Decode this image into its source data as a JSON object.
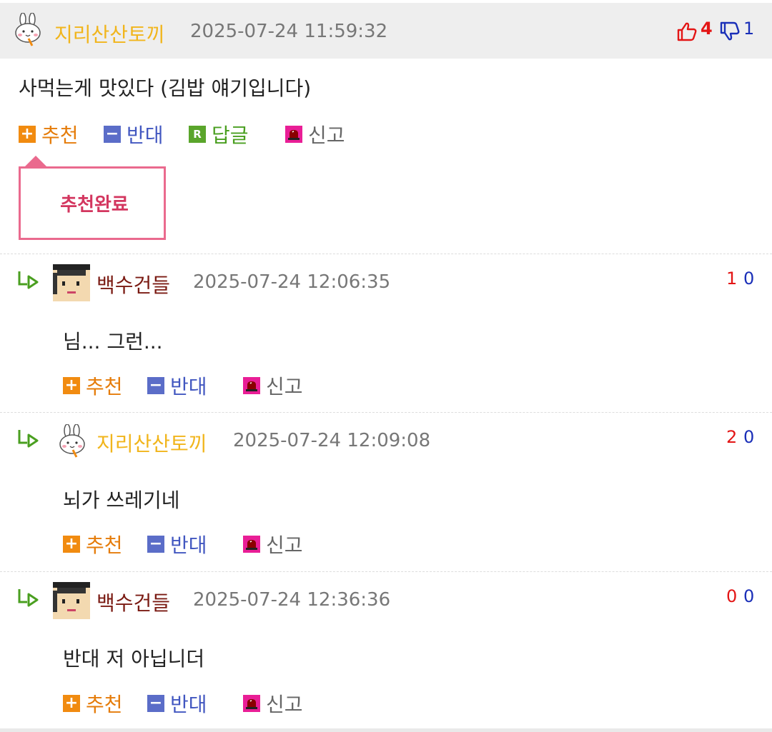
{
  "main_comment": {
    "nickname": "지리산산토끼",
    "date": "2025-07-24 11:59:32",
    "up_count": "4",
    "down_count": "1",
    "text": "사먹는게 맛있다 (김밥 얘기입니다)",
    "actions": {
      "recommend": "추천",
      "oppose": "반대",
      "reply": "답글",
      "report": "신고",
      "reply_icon": "R"
    },
    "popup": "추천완료"
  },
  "replies": [
    {
      "nickname": "백수건들",
      "nickname_color": "#7a1a12",
      "date": "2025-07-24 12:06:35",
      "up": "1",
      "down": "0",
      "text": "님... 그런...",
      "avatar": "graduate-avatar"
    },
    {
      "nickname": "지리산산토끼",
      "nickname_color": "#f1b51c",
      "date": "2025-07-24 12:09:08",
      "up": "2",
      "down": "0",
      "text": "뇌가 쓰레기네",
      "avatar": "rabbit-avatar"
    },
    {
      "nickname": "백수건들",
      "nickname_color": "#7a1a12",
      "date": "2025-07-24 12:36:36",
      "up": "0",
      "down": "0",
      "text": "반대 저 아닙니더",
      "avatar": "graduate-avatar"
    }
  ],
  "reply_actions": {
    "recommend": "추천",
    "oppose": "반대",
    "report": "신고"
  },
  "colors": {
    "up": "#e31515",
    "down": "#1a2fb8",
    "popup_border": "#ea6a8e"
  }
}
